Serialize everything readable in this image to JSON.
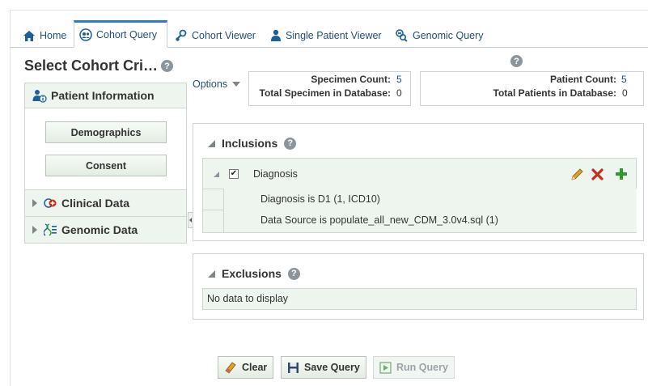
{
  "tabs": [
    {
      "label": "Home",
      "icon": "home-icon",
      "active": false
    },
    {
      "label": "Cohort Query",
      "icon": "cohort-query-icon",
      "active": true
    },
    {
      "label": "Cohort Viewer",
      "icon": "cohort-viewer-icon",
      "active": false
    },
    {
      "label": "Single Patient Viewer",
      "icon": "patient-icon",
      "active": false
    },
    {
      "label": "Genomic Query",
      "icon": "genomic-icon",
      "active": false
    }
  ],
  "left_panel": {
    "title": "Select Cohort Cri…",
    "help": "?",
    "patient_information": {
      "label": "Patient Information",
      "buttons": [
        "Demographics",
        "Consent"
      ]
    },
    "clinical_data": {
      "label": "Clinical Data"
    },
    "genomic_data": {
      "label": "Genomic Data"
    }
  },
  "options": {
    "label": "Options"
  },
  "specimen_counts": {
    "specimen_count_label": "Specimen Count:",
    "specimen_count_value": "5",
    "total_specimen_label": "Total Specimen in Database:",
    "total_specimen_value": "0"
  },
  "patient_counts": {
    "help": "?",
    "patient_count_label": "Patient Count:",
    "patient_count_value": "5",
    "total_patients_label": "Total Patients in Database:",
    "total_patients_value": "0"
  },
  "inclusions": {
    "title": "Inclusions",
    "help": "?",
    "criterion": {
      "label": "Diagnosis",
      "checked": true,
      "details": [
        "Diagnosis is D1 (1, ICD10)",
        "Data Source is populate_all_new_CDM_3.0v4.sql (1)"
      ]
    }
  },
  "exclusions": {
    "title": "Exclusions",
    "help": "?",
    "empty_text": "No data to display"
  },
  "actions": {
    "clear": "Clear",
    "save_query": "Save Query",
    "run_query": "Run Query"
  },
  "colors": {
    "accent": "#2a7cc6",
    "link": "#1f4f7a",
    "panel_green": "#eef5ee",
    "delete_red": "#cc2a1a",
    "add_green": "#2e9a2e"
  }
}
